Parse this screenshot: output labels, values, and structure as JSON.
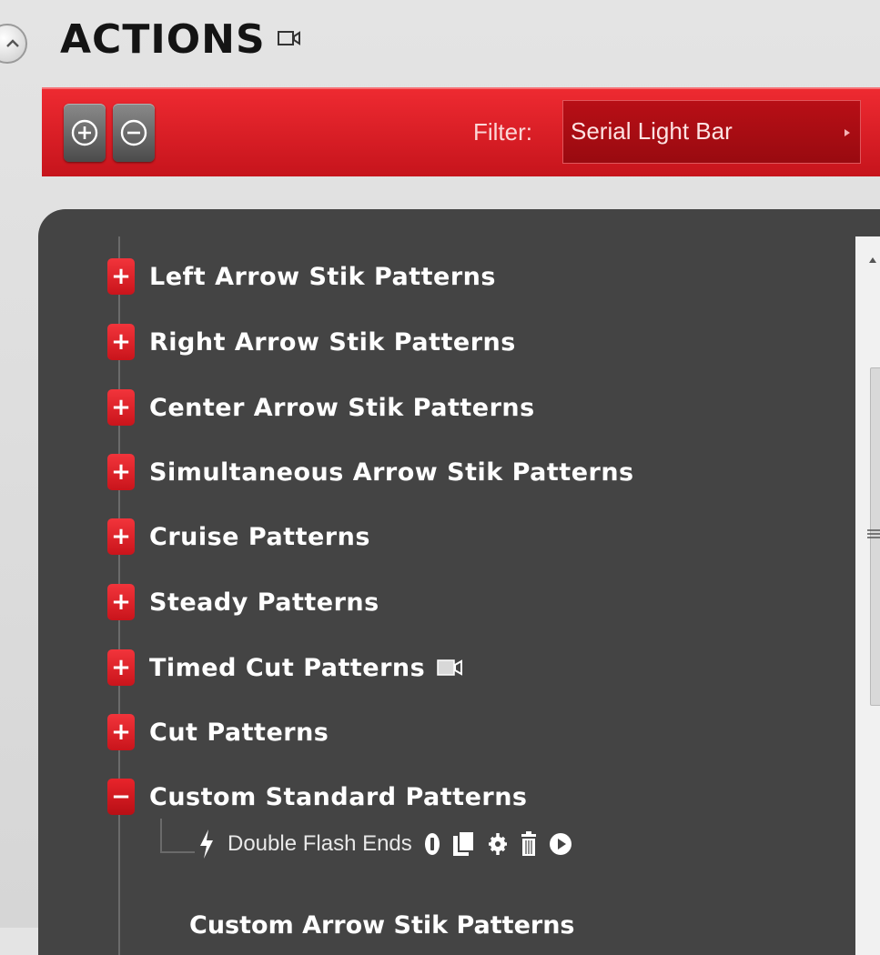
{
  "header": {
    "title": "ACTIONS",
    "collapse_icon": "chevron-up-icon",
    "title_icon": "video-camera-icon"
  },
  "toolbar": {
    "add_icon": "plus-circle-icon",
    "remove_icon": "minus-circle-icon",
    "filter_label": "Filter:",
    "filter_value": "Serial Light Bar"
  },
  "tree": {
    "items": [
      {
        "label": "Left Arrow Stik Patterns",
        "expanded": false
      },
      {
        "label": "Right Arrow Stik Patterns",
        "expanded": false
      },
      {
        "label": "Center Arrow Stik Patterns",
        "expanded": false
      },
      {
        "label": "Simultaneous Arrow Stik Patterns",
        "expanded": false
      },
      {
        "label": "Cruise Patterns",
        "expanded": false
      },
      {
        "label": "Steady Patterns",
        "expanded": false
      },
      {
        "label": "Timed Cut Patterns",
        "expanded": false,
        "icon": "video-camera-icon"
      },
      {
        "label": "Cut Patterns",
        "expanded": false
      },
      {
        "label": "Custom Standard Patterns",
        "expanded": true
      }
    ],
    "child": {
      "icon": "lightning-icon",
      "label": "Double Flash Ends",
      "actions": [
        "info-icon",
        "copy-icon",
        "settings-icon",
        "trash-icon",
        "play-icon"
      ]
    },
    "partial_item": "Custom Arrow Stik Patterns"
  },
  "colors": {
    "accent_red": "#d71920",
    "panel_bg": "#444444",
    "page_bg": "#dedede"
  }
}
